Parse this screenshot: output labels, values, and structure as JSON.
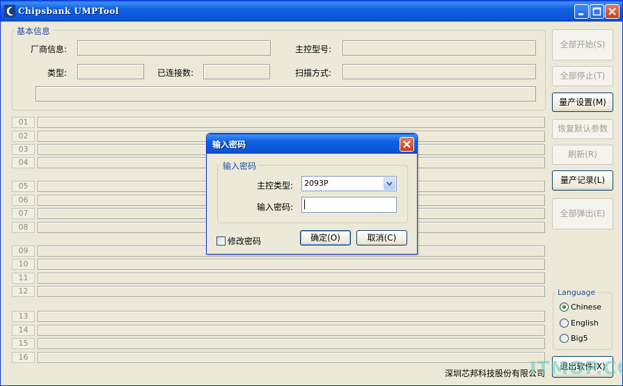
{
  "window": {
    "title": "Chipsbank UMPTool"
  },
  "info": {
    "group_title": "基本信息",
    "vendor_label": "厂商信息:",
    "controller_label": "主控型号:",
    "type_label": "类型:",
    "connected_label": "已连接数:",
    "scan_label": "扫描方式:"
  },
  "slots": [
    "01",
    "02",
    "03",
    "04",
    "05",
    "06",
    "07",
    "08",
    "09",
    "10",
    "11",
    "12",
    "13",
    "14",
    "15",
    "16"
  ],
  "buttons": {
    "start_all": "全部开始(S)",
    "stop_all": "全部停止(T)",
    "settings": "量产设置(M)",
    "restore": "恢复默认参数",
    "refresh": "刷新(R)",
    "log": "量产记录(L)",
    "eject_all": "全部弹出(E)",
    "exit": "退出软件(X)"
  },
  "language": {
    "title": "Language",
    "options": [
      "Chinese",
      "English",
      "Big5"
    ],
    "selected": "Chinese"
  },
  "company": "深圳芯邦科技股份有限公司",
  "watermark": "ITMOP.COM",
  "dialog": {
    "title": "输入密码",
    "group_title": "输入密码",
    "controller_label": "主控类型:",
    "controller_value": "2093P",
    "password_label": "输入密码:",
    "password_value": "",
    "change_password": "修改密码",
    "ok": "确定(O)",
    "cancel": "取消(C)"
  }
}
